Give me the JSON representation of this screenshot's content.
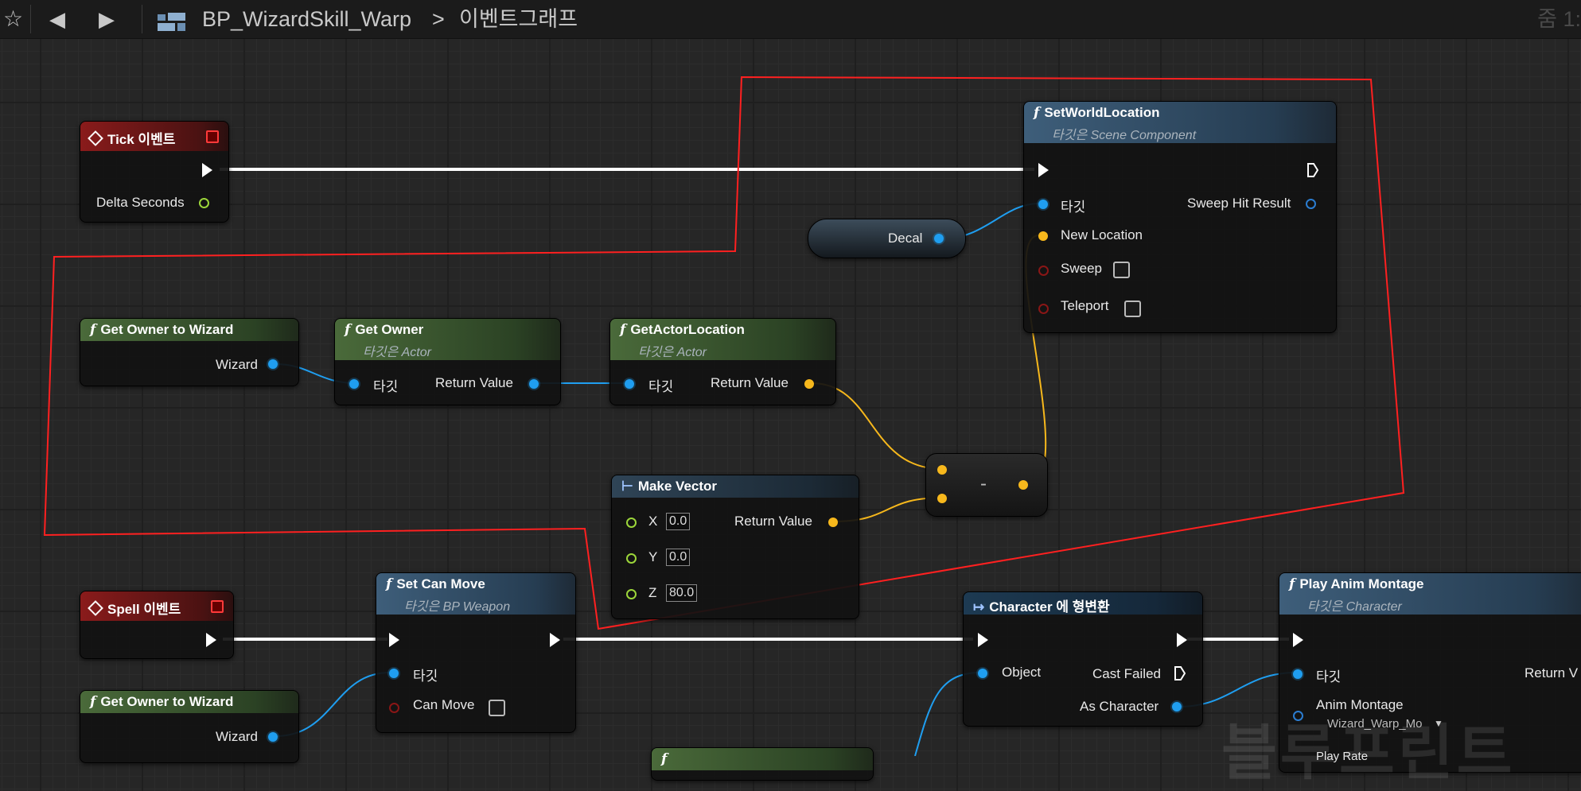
{
  "toolbar": {
    "breadcrumb_asset": "BP_WizardSkill_Warp",
    "breadcrumb_sep": ">",
    "breadcrumb_graph": "이벤트그래프",
    "zoom": "줌 1:"
  },
  "nodes": {
    "tick_event": {
      "title": "Tick 이벤트",
      "delta": "Delta Seconds"
    },
    "set_world_location": {
      "title": "SetWorldLocation",
      "subtitle": "타깃은 Scene Component",
      "target": "타깃",
      "new_location": "New Location",
      "sweep": "Sweep",
      "teleport": "Teleport",
      "sweep_hit": "Sweep Hit Result"
    },
    "decal": {
      "label": "Decal"
    },
    "get_owner_wizard_1": {
      "title": "Get Owner to Wizard",
      "out": "Wizard"
    },
    "get_owner": {
      "title": "Get Owner",
      "subtitle": "타깃은 Actor",
      "target": "타깃",
      "ret": "Return Value"
    },
    "get_actor_location": {
      "title": "GetActorLocation",
      "subtitle": "타깃은 Actor",
      "target": "타깃",
      "ret": "Return Value"
    },
    "subtract": {
      "symbol": "-"
    },
    "make_vector": {
      "title": "Make Vector",
      "x_label": "X",
      "x": "0.0",
      "y_label": "Y",
      "y": "0.0",
      "z_label": "Z",
      "z": "80.0",
      "ret": "Return Value"
    },
    "spell_event": {
      "title": "Spell 이벤트"
    },
    "set_can_move": {
      "title": "Set Can Move",
      "subtitle": "타깃은 BP Weapon",
      "target": "타깃",
      "can_move": "Can Move"
    },
    "get_owner_wizard_2": {
      "title": "Get Owner to Wizard",
      "out": "Wizard"
    },
    "cast_character": {
      "title": "Character 에 형변환",
      "object": "Object",
      "cast_failed": "Cast Failed",
      "as_character": "As Character"
    },
    "play_anim_montage": {
      "title": "Play Anim Montage",
      "subtitle": "타깃은 Character",
      "target": "타깃",
      "anim_montage": "Anim Montage",
      "montage_value": "Wizard_Warp_Mo",
      "ret": "Return V",
      "play_rate": "Play Rate"
    }
  },
  "watermark": "블루프린트",
  "colors": {
    "exec_wire": "#ffffff",
    "object_wire": "#1f9ef0",
    "vector_wire": "#f7b81c",
    "highlight": "#ff2020",
    "event_head": "#8a1b1b",
    "func_head": "#3e5e7a",
    "pure_head": "#4a6a3a"
  }
}
